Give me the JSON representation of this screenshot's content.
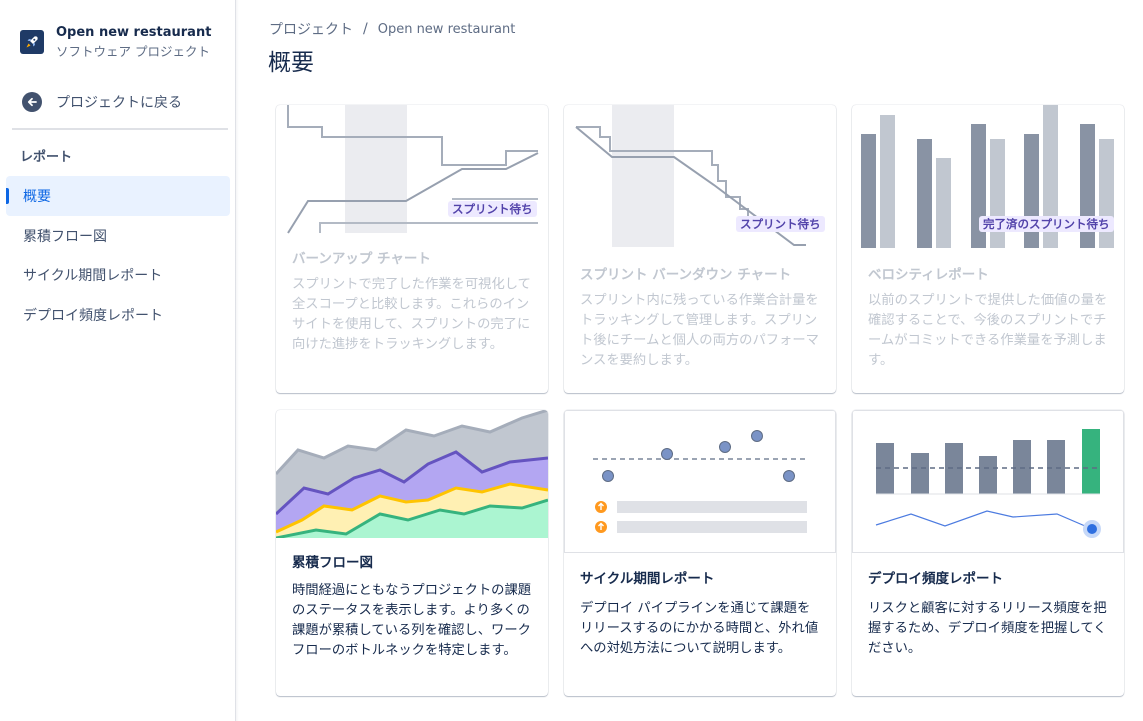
{
  "project": {
    "name": "Open new restaurant",
    "type": "ソフトウェア プロジェクト"
  },
  "sidebar": {
    "back_label": "プロジェクトに戻る",
    "section": "レポート",
    "items": [
      {
        "label": "概要",
        "active": true
      },
      {
        "label": "累積フロー図",
        "active": false
      },
      {
        "label": "サイクル期間レポート",
        "active": false
      },
      {
        "label": "デプロイ頻度レポート",
        "active": false
      }
    ]
  },
  "breadcrumb": {
    "items": [
      "プロジェクト",
      "Open new restaurant"
    ],
    "separator": "/"
  },
  "page": {
    "title": "概要"
  },
  "cards": [
    {
      "title": "バーンアップ チャート",
      "desc": "スプリントで完了した作業を可視化して全スコープと比較します。これらのインサイトを使用して、スプリントの完了に向けた進捗をトラッキングします。",
      "badge": "スプリント待ち",
      "disabled": true
    },
    {
      "title": "スプリント バーンダウン チャート",
      "desc": "スプリント内に残っている作業合計量をトラッキングして管理します。スプリント後にチームと個人の両方のパフォーマンスを要約します。",
      "badge": "スプリント待ち",
      "disabled": true
    },
    {
      "title": "ベロシティレポート",
      "desc": "以前のスプリントで提供した価値の量を確認することで、今後のスプリントでチームがコミットできる作業量を予測します。",
      "badge": "完了済のスプリント待ち",
      "disabled": true
    },
    {
      "title": "累積フロー図",
      "desc": "時間経過にともなうプロジェクトの課題のステータスを表示します。より多くの課題が累積している列を確認し、ワークフローのボトルネックを特定します。",
      "disabled": false
    },
    {
      "title": "サイクル期間レポート",
      "desc": "デプロイ パイプラインを通じて課題をリリースするのにかかる時間と、外れ値への対処方法について説明します。",
      "disabled": false
    },
    {
      "title": "デプロイ頻度レポート",
      "desc": "リスクと顧客に対するリリース頻度を把握するため、デプロイ頻度を把握してください。",
      "disabled": false
    }
  ],
  "colors": {
    "accent": "#0c66e4",
    "lozenge_bg": "#ede9ff",
    "lozenge_text": "#5243aa",
    "cfd_gray": "#c1c7d0",
    "cfd_purple": "#b3a6f2",
    "cfd_yellow": "#fff0b3",
    "cfd_green": "#abf5d1",
    "deploy_bar": "#7a869a",
    "deploy_highlight": "#36b37e"
  },
  "icons": {
    "project_avatar": "rocket-icon",
    "back": "arrow-left-circle-icon"
  }
}
